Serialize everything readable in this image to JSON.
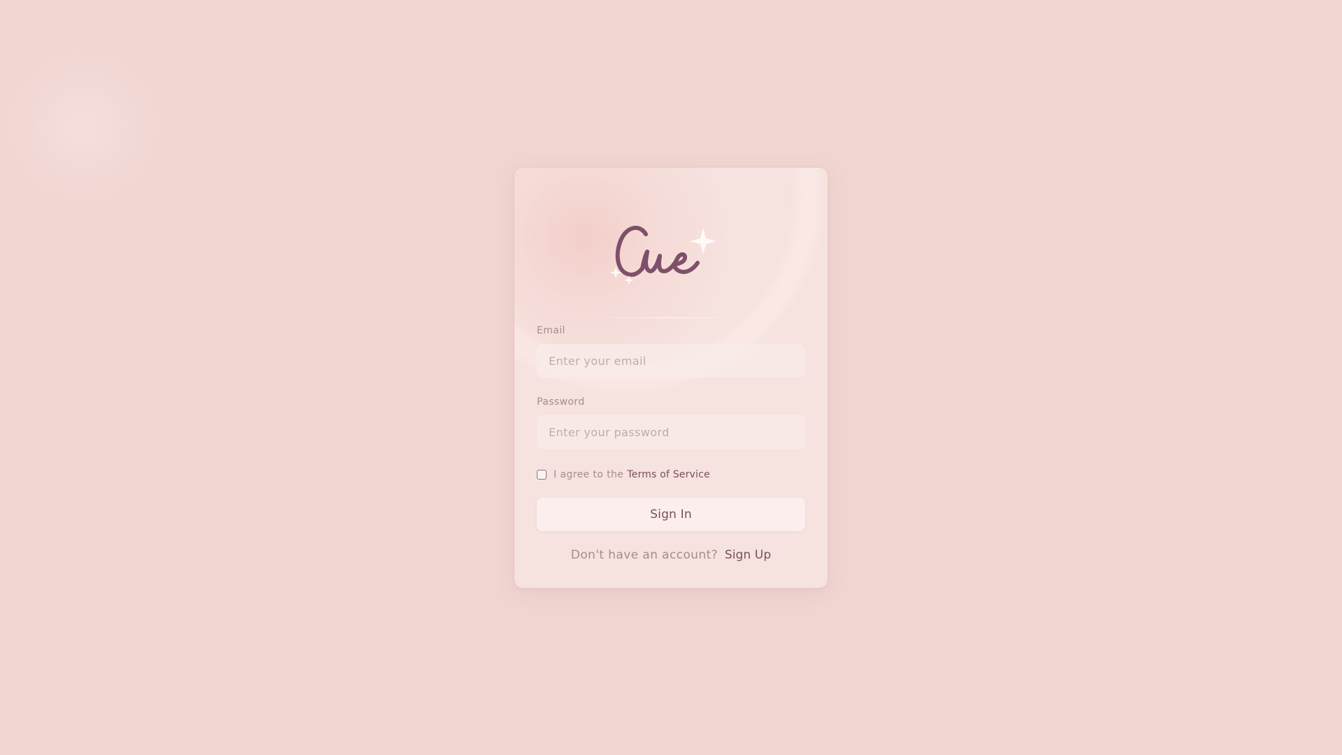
{
  "app": {
    "logo_text": "Cue",
    "logo_color": "#7f5069",
    "accent_color": "#7a4e5e",
    "background_color": "#f0d5d1"
  },
  "form": {
    "email": {
      "label": "Email",
      "placeholder": "Enter your email",
      "value": ""
    },
    "password": {
      "label": "Password",
      "placeholder": "Enter your password",
      "value": ""
    },
    "terms": {
      "checked": false,
      "text": "I agree to the",
      "link_text": "Terms of Service"
    },
    "submit_label": "Sign In",
    "signup": {
      "prompt": "Don't have an account?",
      "link_text": "Sign Up"
    }
  },
  "icons": {
    "logo_sparkles": "sparkle-icon",
    "checkbox": "checkbox-icon"
  }
}
